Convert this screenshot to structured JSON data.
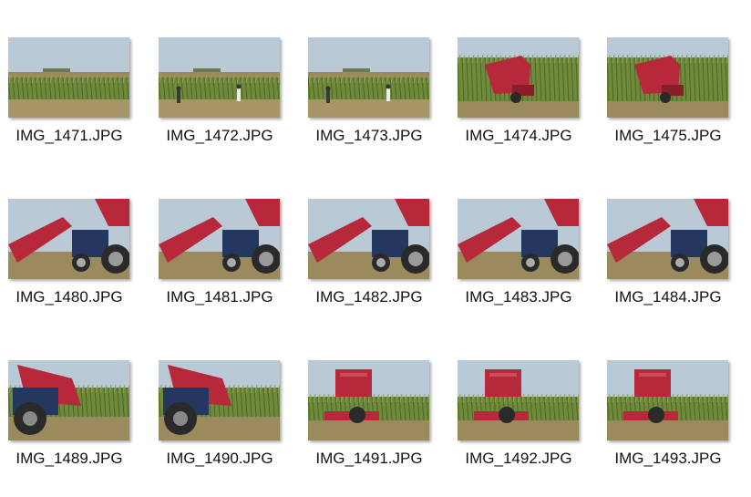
{
  "files": [
    {
      "name": "IMG_1471.JPG",
      "scene": "field-wide"
    },
    {
      "name": "IMG_1472.JPG",
      "scene": "field-people"
    },
    {
      "name": "IMG_1473.JPG",
      "scene": "field-people"
    },
    {
      "name": "IMG_1474.JPG",
      "scene": "harvester-in-corn"
    },
    {
      "name": "IMG_1475.JPG",
      "scene": "harvester-in-corn"
    },
    {
      "name": "IMG_1480.JPG",
      "scene": "harvester-header-close"
    },
    {
      "name": "IMG_1481.JPG",
      "scene": "harvester-header-close"
    },
    {
      "name": "IMG_1482.JPG",
      "scene": "harvester-tractor-side"
    },
    {
      "name": "IMG_1483.JPG",
      "scene": "harvester-tractor-side"
    },
    {
      "name": "IMG_1484.JPG",
      "scene": "harvester-tractor-far"
    },
    {
      "name": "IMG_1489.JPG",
      "scene": "tractor-rear-low"
    },
    {
      "name": "IMG_1490.JPG",
      "scene": "tractor-rear-low"
    },
    {
      "name": "IMG_1491.JPG",
      "scene": "harvester-rear"
    },
    {
      "name": "IMG_1492.JPG",
      "scene": "harvester-bin-rear"
    },
    {
      "name": "IMG_1493.JPG",
      "scene": "harvester-bin-rear"
    }
  ],
  "colors": {
    "sky": "#b9c9d6",
    "corn": "#6f8a3a",
    "ground": "#9a8a5e",
    "machine_red": "#b6283a",
    "tractor_blue": "#24375e",
    "tire": "#2a2a2a"
  }
}
